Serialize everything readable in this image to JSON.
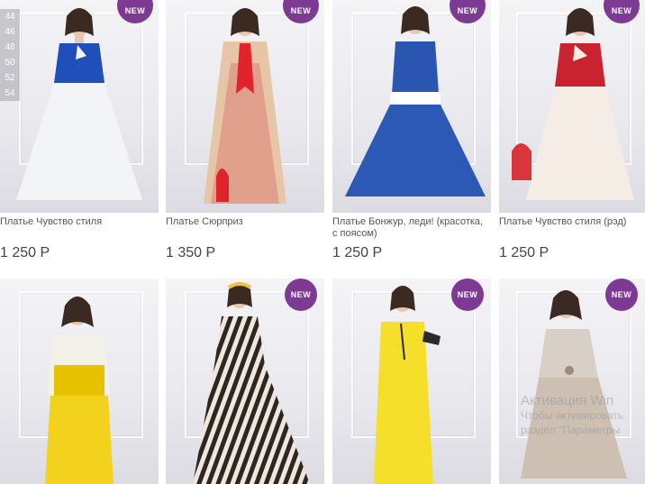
{
  "badge_text": "NEW",
  "size_filter": [
    "44",
    "46",
    "48",
    "50",
    "52",
    "54"
  ],
  "products": [
    {
      "name": "Платье Чувство стиля",
      "price": "1 250 Р",
      "is_new": true,
      "top_color": "#1f4fb8",
      "skirt_color": "#f2f4f6",
      "accent": "#2a4ea8"
    },
    {
      "name": "Платье Сюрприз",
      "price": "1 350 Р",
      "is_new": true,
      "top_color": "#e7c6a8",
      "skirt_color": "#e0a08c",
      "accent": "#e0242a"
    },
    {
      "name": "Платье Бонжур, леди! (красотка, с поясом)",
      "price": "1 250 Р",
      "is_new": true,
      "top_color": "#2a55b0",
      "skirt_color": "#2d59b6",
      "accent": "#ffffff"
    },
    {
      "name": "Платье Чувство стиля (рэд)",
      "price": "1 250 Р",
      "is_new": true,
      "top_color": "#c8232e",
      "skirt_color": "#f5ece6",
      "accent": "#d9363c"
    },
    {
      "is_new": false,
      "top_color": "#f3f0e8",
      "skirt_color": "#f2d21c",
      "accent": "#e7c200"
    },
    {
      "is_new": true,
      "top_color": "#2d2622",
      "skirt_color": "#efe6dc",
      "accent": "#f0c13a"
    },
    {
      "is_new": true,
      "top_color": "#f6df2a",
      "skirt_color": "#f5dc22",
      "accent": "#2a2a2a"
    },
    {
      "is_new": true,
      "top_color": "#d8cfc6",
      "skirt_color": "#cdbfb2",
      "accent": "#9a8a80"
    }
  ],
  "watermark": {
    "line1": "Активация Win",
    "line2": "Чтобы активировать",
    "line3": "раздел \"Параметры"
  }
}
